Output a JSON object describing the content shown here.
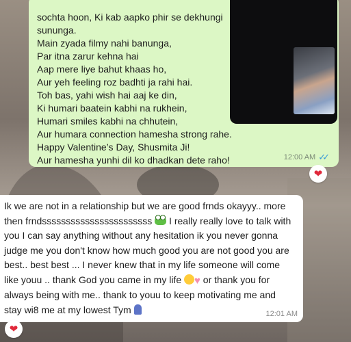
{
  "outgoing": {
    "lines": [
      "sochta hoon,  Ki kab aapko phir se dekhungi",
      "sununga.",
      "Main zyada filmy nahi banunga,",
      "Par itna zarur kehna hai",
      "Aap mere liye bahut khaas ho,",
      "Aur yeh feeling roz badhti ja rahi hai.",
      "Toh bas, yahi wish hai aaj ke din,",
      "Ki humari baatein kabhi na rukhein,",
      "Humari smiles kabhi na chhutein,",
      "Aur humara connection hamesha strong rahe.",
      "Happy Valentine’s Day, Shusmita Ji!",
      "Aur hamesha yunhi dil ko dhadkan dete raho!"
    ],
    "time": "12:00 AM",
    "status_icon": "double-check-read-icon",
    "tick_color": "#3b9bd6",
    "bubble_color": "#dcf7c5"
  },
  "video_call": {
    "overlay_icon": "video-call-overlay"
  },
  "reactions": {
    "first": "❤",
    "second": "❤"
  },
  "incoming": {
    "seg1": "Ik we are not in a relationship but we are good frnds okayyy.. more",
    "seg2a": "then frndsssssssssssssssssssssss",
    "seg2b": " I really really love to talk with",
    "seg3": "you I can say anything without any hesitation ik you never gonna",
    "seg4": "judge me you don't know how much good you are not good you are",
    "seg5": "best.. best best ... I never knew that in my life someone will come",
    "seg6a": "like youu .. thank God you came in my life ",
    "seg6b": "  or thank you for",
    "seg7": "always being with me.. thank to youu to keep motivating me and",
    "seg8": "stay wi8 me at my lowest Tym ",
    "time": "12:01 AM",
    "bubble_color": "#ffffff"
  }
}
